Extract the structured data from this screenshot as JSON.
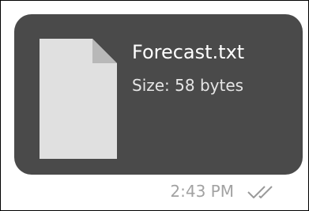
{
  "message": {
    "attachment": {
      "icon": "document-icon",
      "file_name": "Forecast.txt",
      "size_label": "Size: 58 bytes"
    },
    "timestamp": "2:43 PM",
    "status_icon": "double-check-icon",
    "colors": {
      "bubble": "#4a4a4a",
      "file_icon": "#e0e0e0",
      "file_icon_fold": "#b8b8b8",
      "timestamp": "#a2a2a2",
      "status": "#9a9a9a"
    }
  }
}
